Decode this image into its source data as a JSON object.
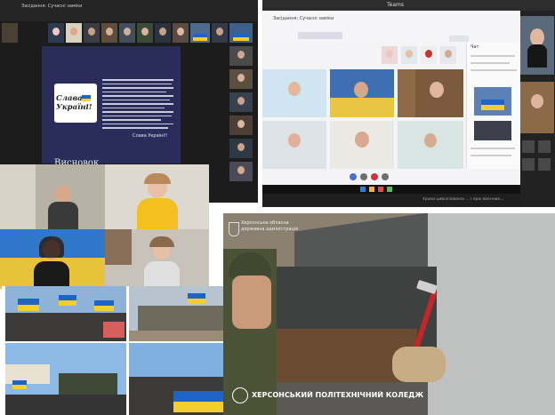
{
  "zoom_window_top": {
    "meeting_title": "Засідання: Сучасні заміки",
    "poster": {
      "badge_text": "Слава Україні!",
      "heading": "Висновок",
      "footer": "Слава Україні!!"
    }
  },
  "zoom_window_right": {
    "title": "Teams",
    "meeting_title": "Засідання: Сучасні заміки",
    "chat_title": "Чат",
    "caption": "Уроки цивілізованої ... Герої воєнних..."
  },
  "kherson_photo": {
    "admin_label": "Херсонська обласна державна адміністрація",
    "college_label": "ХЕРСОНСЬКИЙ ПОЛІТЕХНІЧНИЙ КОЛЕДЖ"
  },
  "colors": {
    "ua_blue": "#1e63c6",
    "ua_yellow": "#f2cf2c",
    "zoom_dark": "#1f1f1f",
    "poster_bg": "#2a2d59"
  }
}
